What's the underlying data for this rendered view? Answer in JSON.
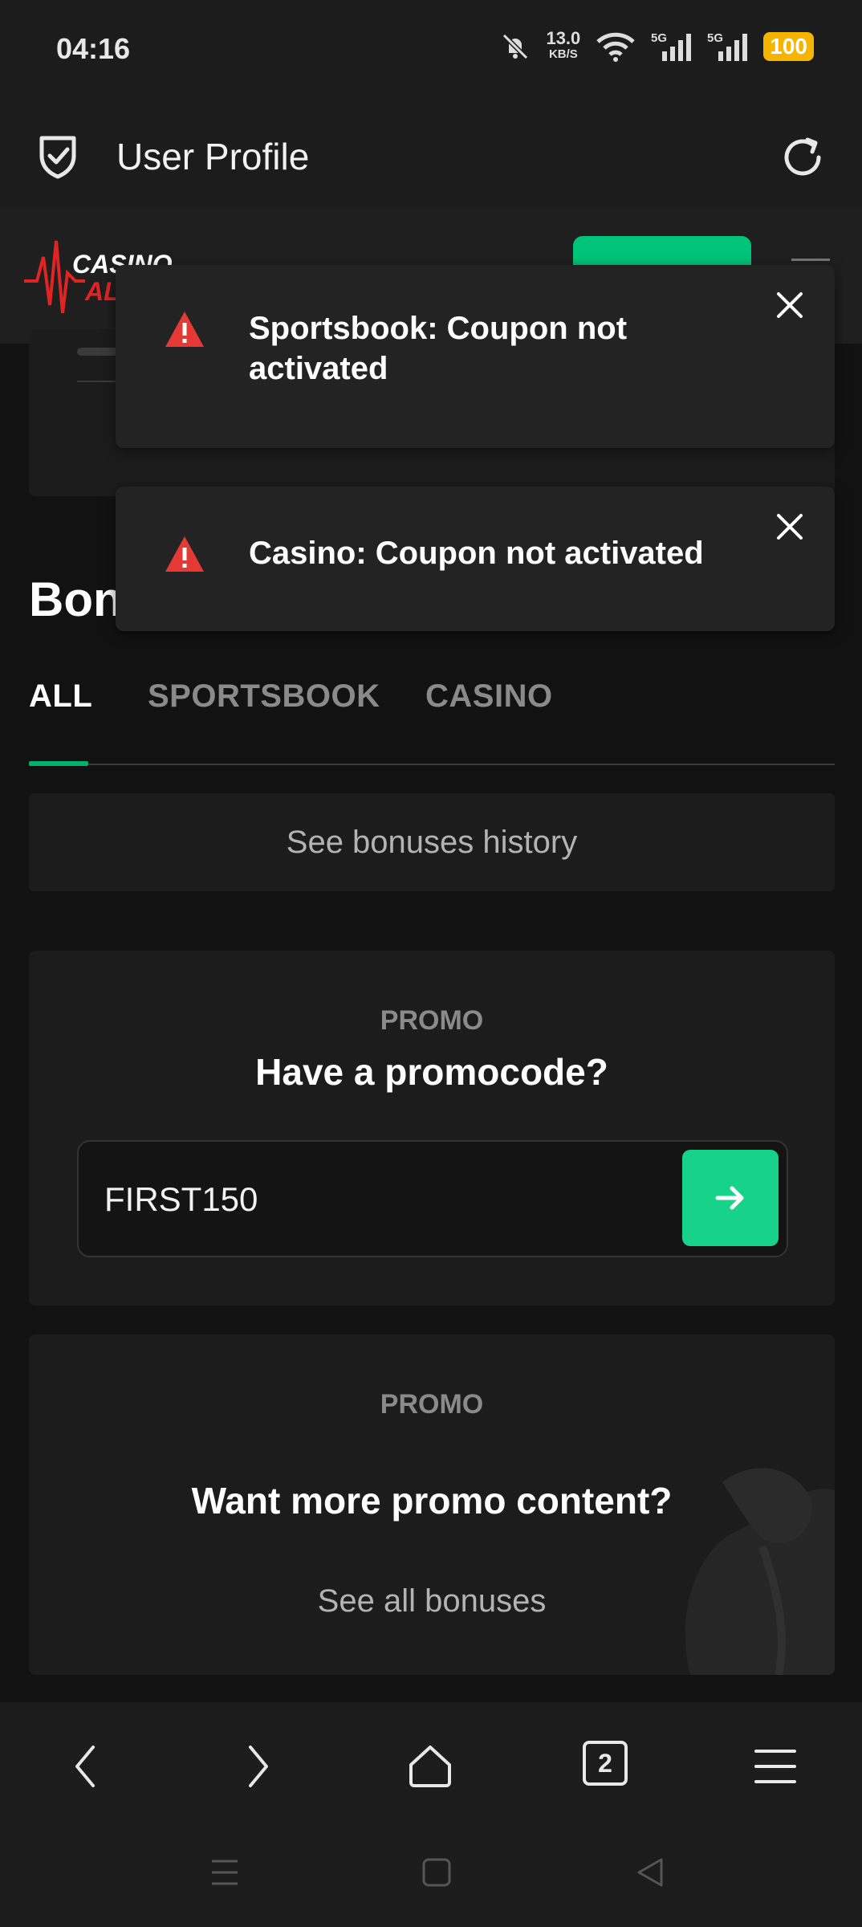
{
  "status_bar": {
    "time": "04:16",
    "net_speed_value": "13.0",
    "net_speed_unit": "KB/S",
    "sim1": "5G",
    "sim2": "5G",
    "battery": "100"
  },
  "app_bar": {
    "title": "User Profile",
    "icons": [
      "shield-check-icon",
      "refresh-icon"
    ]
  },
  "site_header": {
    "logo_text_top": "CASINO",
    "logo_text_bottom": "AL"
  },
  "toasts": [
    {
      "message": "Sportsbook: Coupon not activated",
      "icon": "warning-icon",
      "color": "#e53935"
    },
    {
      "message": "Casino: Coupon not activated",
      "icon": "warning-icon",
      "color": "#e53935"
    }
  ],
  "bonuses": {
    "title": "Bon",
    "tabs": [
      {
        "label": "ALL",
        "active": true
      },
      {
        "label": "SPORTSBOOK",
        "active": false
      },
      {
        "label": "CASINO",
        "active": false
      }
    ],
    "history_label": "See bonuses history"
  },
  "promo_code": {
    "kicker": "PROMO",
    "heading": "Have a promocode?",
    "input_value": "FIRST150"
  },
  "promo_more": {
    "kicker": "PROMO",
    "heading": "Want more promo content?",
    "link": "See all bonuses"
  },
  "browser_nav": {
    "tab_count": "2"
  },
  "colors": {
    "accent": "#17d38a",
    "brand_green": "#00c47a",
    "warning": "#e53935",
    "battery": "#f5b400"
  }
}
